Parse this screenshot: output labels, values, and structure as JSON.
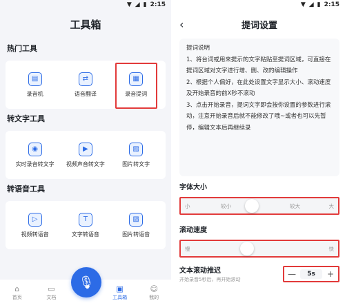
{
  "statusbar": {
    "time": "2:15"
  },
  "left": {
    "title": "工具箱",
    "sections": [
      {
        "title": "热门工具",
        "tools": [
          {
            "label": "录音机",
            "icon": "radio-icon"
          },
          {
            "label": "语音翻译",
            "icon": "translate-icon"
          },
          {
            "label": "录音提词",
            "icon": "teleprompter-icon",
            "highlighted": true
          }
        ]
      },
      {
        "title": "转文字工具",
        "tools": [
          {
            "label": "实时录音转文字",
            "icon": "live-transcribe-icon"
          },
          {
            "label": "视频声音转文字",
            "icon": "video-to-text-icon"
          },
          {
            "label": "图片转文字",
            "icon": "image-to-text-icon"
          }
        ]
      },
      {
        "title": "转语音工具",
        "tools": [
          {
            "label": "视频转语音",
            "icon": "video-to-audio-icon"
          },
          {
            "label": "文字转语音",
            "icon": "text-to-speech-icon"
          },
          {
            "label": "图片转语音",
            "icon": "image-to-audio-icon"
          }
        ]
      }
    ],
    "tabs": [
      {
        "label": "首页",
        "icon": "home-icon"
      },
      {
        "label": "文档",
        "icon": "folder-icon"
      },
      {
        "label": "",
        "icon": "mic-icon"
      },
      {
        "label": "工具箱",
        "icon": "toolbox-icon",
        "active": true
      },
      {
        "label": "我的",
        "icon": "profile-icon"
      }
    ]
  },
  "right": {
    "title": "提词设置",
    "description": {
      "heading": "提词说明",
      "items": [
        "1、将台词或用来提示的文字粘贴至提词区域，可直接在提词区域对文字进行增、删、改的编辑操作",
        "2、根据个人偏好，在此处设置文字显示大小、滚动速度及开始录音的前X秒不滚动",
        "3、点击开始录音，提词文字即会按你设置的参数进行滚动，注意开始录音后就不能修改了哦~或者也可以先暂停，编辑文本后再继续录"
      ]
    },
    "font_size": {
      "label": "字体大小",
      "options": [
        "小",
        "较小",
        "较大",
        "大"
      ],
      "value_fraction": 0.45
    },
    "scroll_speed": {
      "label": "滚动速度",
      "min_label": "慢",
      "max_label": "快",
      "value_fraction": 0.42
    },
    "delay": {
      "label": "文本滚动推迟",
      "hint": "开始录音5秒后，再开始滚动",
      "value": "5s",
      "minus": "—",
      "plus": "+"
    }
  }
}
